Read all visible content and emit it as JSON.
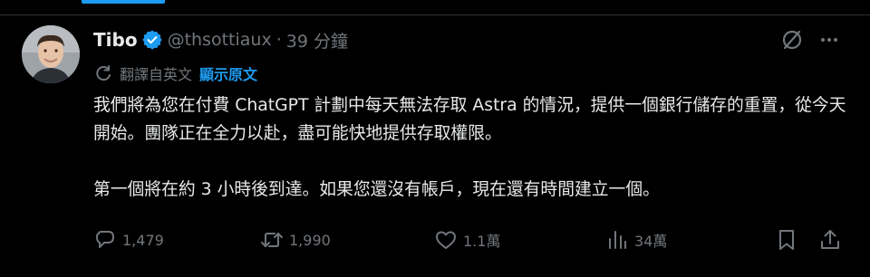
{
  "tweet": {
    "author_name": "Tibo",
    "handle": "@thsottiaux",
    "separator": "·",
    "time": "39 分鐘",
    "translated_label": "翻譯自英文",
    "show_original_label": "顯示原文",
    "paragraphs": [
      "我們將為您在付費 ChatGPT 計劃中每天無法存取 Astra 的情況，提供一個銀行儲存的重置，從今天開始。團隊正在全力以赴，盡可能快地提供存取權限。",
      "第一個將在約 3 小時後到達。如果您還沒有帳戶，現在還有時間建立一個。"
    ],
    "actions": {
      "replies": "1,479",
      "reposts": "1,990",
      "likes": "1.1萬",
      "views": "34萬"
    }
  },
  "icons": {
    "verified": "verified-badge-icon",
    "grok": "grok-icon",
    "more": "more-icon",
    "translate": "translate-icon",
    "reply": "reply-icon",
    "repost": "repost-icon",
    "like": "like-icon",
    "views": "views-icon",
    "bookmark": "bookmark-icon",
    "share": "share-icon"
  },
  "colors": {
    "background": "#000000",
    "text_primary": "#e7e9ea",
    "text_secondary": "#71767b",
    "accent": "#1d9bf0",
    "divider": "#2f3336"
  }
}
